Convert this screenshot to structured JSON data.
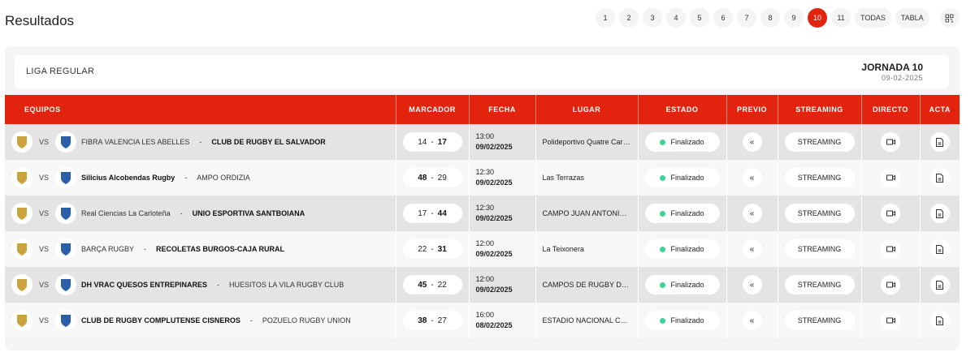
{
  "page_title": "Resultados",
  "pager": {
    "pages": [
      "1",
      "2",
      "3",
      "4",
      "5",
      "6",
      "7",
      "8",
      "9",
      "10",
      "11"
    ],
    "active": "10",
    "todas": "TODAS",
    "tabla": "TABLA",
    "qr_icon": "qr-code-icon"
  },
  "section": {
    "liga": "LIGA REGULAR",
    "jornada": "JORNADA 10",
    "date": "09-02-2025"
  },
  "columns": [
    "EQUIPOS",
    "MARCADOR",
    "FECHA",
    "LUGAR",
    "ESTADO",
    "PREVIO",
    "STREAMING",
    "DIRECTO",
    "ACTA"
  ],
  "vs_label": "VS",
  "colors": {
    "accent": "#e2230e",
    "status_dot": "#3ed392"
  },
  "matches": [
    {
      "home": "FIBRA VALENCIA LES ABELLES",
      "away": "CLUB DE RUGBY EL SALVADOR",
      "home_score": "14",
      "away_score": "17",
      "winner": "away",
      "time": "13:00",
      "date": "09/02/2025",
      "venue": "Polideportivo Quatre Carreres",
      "status": "Finalizado",
      "streaming": "STREAMING"
    },
    {
      "home": "Silicius Alcobendas Rugby",
      "away": "AMPO ORDIZIA",
      "home_score": "48",
      "away_score": "29",
      "winner": "home",
      "time": "12:30",
      "date": "09/02/2025",
      "venue": "Las Terrazas",
      "status": "Finalizado",
      "streaming": "STREAMING"
    },
    {
      "home": "Real Ciencias La Carloteña",
      "away": "UNIO ESPORTIVA SANTBOIANA",
      "home_score": "17",
      "away_score": "44",
      "winner": "away",
      "time": "12:30",
      "date": "09/02/2025",
      "venue": "CAMPO JUAN ANTONIO SAMARANCH",
      "status": "Finalizado",
      "streaming": "STREAMING"
    },
    {
      "home": "BARÇA RUGBY",
      "away": "RECOLETAS BURGOS-CAJA RURAL",
      "home_score": "22",
      "away_score": "31",
      "winner": "away",
      "time": "12:00",
      "date": "09/02/2025",
      "venue": "La Teixonera",
      "status": "Finalizado",
      "streaming": "STREAMING"
    },
    {
      "home": "DH VRAC QUESOS ENTREPINARES",
      "away": "HUESITOS LA VILA RUGBY CLUB",
      "home_score": "45",
      "away_score": "22",
      "winner": "home",
      "time": "12:00",
      "date": "09/02/2025",
      "venue": "CAMPOS DE RUGBY DE PEPE ROJO",
      "status": "Finalizado",
      "streaming": "STREAMING"
    },
    {
      "home": "CLUB DE RUGBY COMPLUTENSE CISNEROS",
      "away": "POZUELO RUGBY UNION",
      "home_score": "38",
      "away_score": "27",
      "winner": "home",
      "time": "16:00",
      "date": "08/02/2025",
      "venue": "ESTADIO NACIONAL COMPLUTENSE",
      "status": "Finalizado",
      "streaming": "STREAMING"
    }
  ]
}
